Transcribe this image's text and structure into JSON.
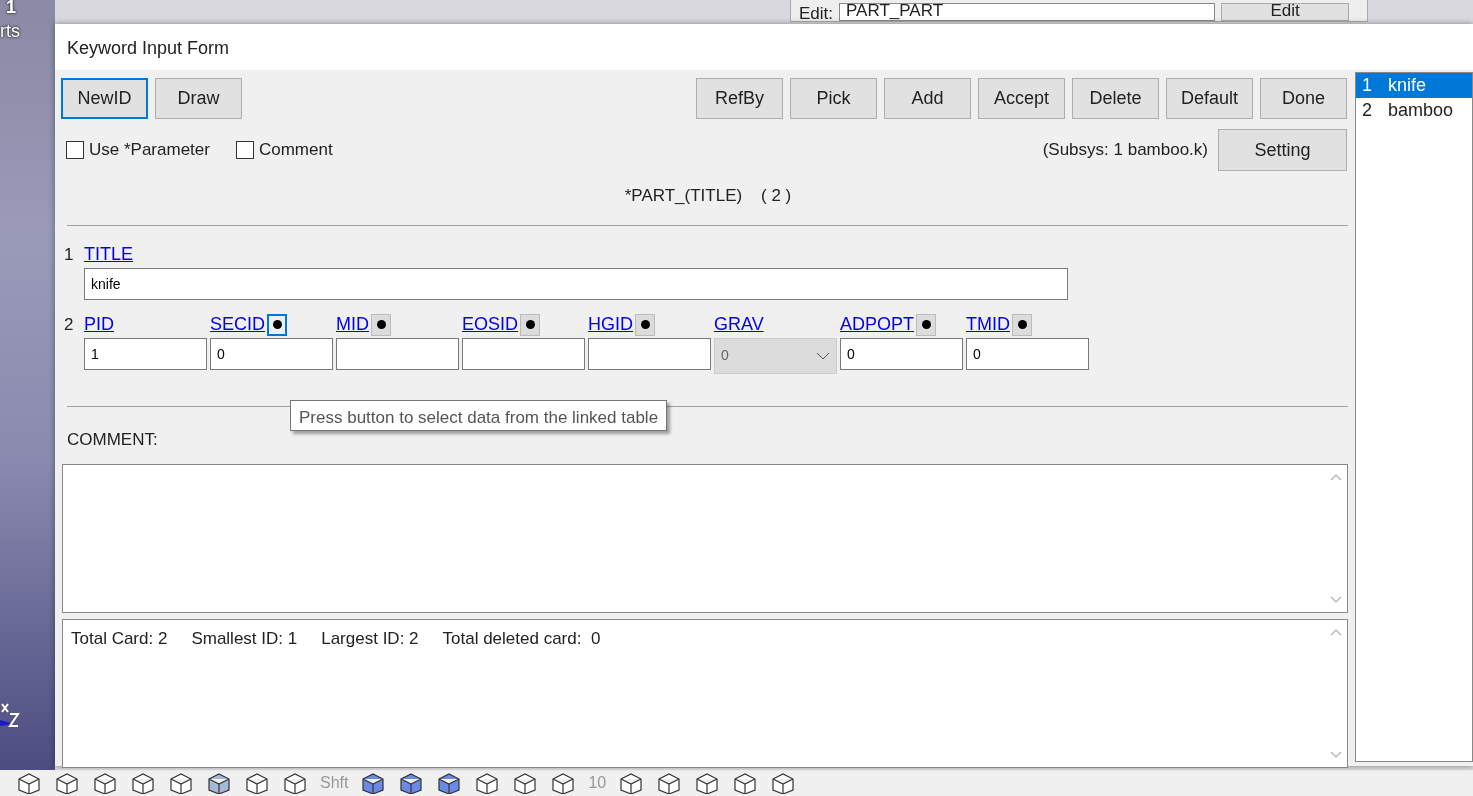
{
  "desktop": {
    "corner_texts": [
      "1",
      "rts"
    ],
    "top_panel": {
      "label": "Edit:",
      "select_value": "PART_PART",
      "button": "Edit"
    },
    "toolbar": {
      "texts": [
        "Shft",
        "10"
      ]
    }
  },
  "window": {
    "title": "Keyword Input Form"
  },
  "left_buttons": [
    {
      "label": "NewID",
      "focused": true
    },
    {
      "label": "Draw",
      "focused": false
    }
  ],
  "right_buttons": [
    {
      "label": "RefBy",
      "focused": false
    },
    {
      "label": "Pick",
      "focused": false
    },
    {
      "label": "Add",
      "focused": false
    },
    {
      "label": "Accept",
      "focused": false
    },
    {
      "label": "Delete",
      "focused": false
    },
    {
      "label": "Default",
      "focused": false
    },
    {
      "label": "Done",
      "focused": false
    }
  ],
  "options": [
    {
      "label": "Use *Parameter",
      "checked": false
    },
    {
      "label": "Comment",
      "checked": false
    }
  ],
  "subsys": "(Subsys: 1 bamboo.k)",
  "setting_button": "Setting",
  "keyword_heading": "*PART_(TITLE)    ( 2 )",
  "cards": [
    {
      "number": "1",
      "fields": [
        {
          "label": "TITLE",
          "kind": "wide",
          "value": "knife",
          "link_button": false
        }
      ]
    },
    {
      "number": "2",
      "fields": [
        {
          "label": "PID",
          "kind": "input",
          "value": "1",
          "link_button": false
        },
        {
          "label": "SECID",
          "kind": "input",
          "value": "0",
          "link_button": true,
          "focused": true
        },
        {
          "label": "MID",
          "kind": "input",
          "link_button": true,
          "focused": false
        },
        {
          "label": "EOSID",
          "kind": "input",
          "link_button": true,
          "focused": false
        },
        {
          "label": "HGID",
          "kind": "input",
          "link_button": true,
          "focused": false
        },
        {
          "label": "GRAV",
          "kind": "select",
          "value": "0",
          "disabled": true,
          "link_button": false
        },
        {
          "label": "ADPOPT",
          "kind": "input",
          "value": "0",
          "link_button": true,
          "focused": false
        },
        {
          "label": "TMID",
          "kind": "input",
          "value": "0",
          "link_button": true,
          "focused": false
        }
      ]
    }
  ],
  "tooltip": "Press button to select data from the linked table",
  "comment_label": "COMMENT:",
  "summary": [
    "Total Card: 2",
    "Smallest ID: 1",
    "Largest ID: 2",
    "Total deleted card:  0"
  ],
  "id_list": [
    {
      "number": "1",
      "name": "knife",
      "selected": true
    },
    {
      "number": "2",
      "name": "bamboo",
      "selected": false
    }
  ]
}
